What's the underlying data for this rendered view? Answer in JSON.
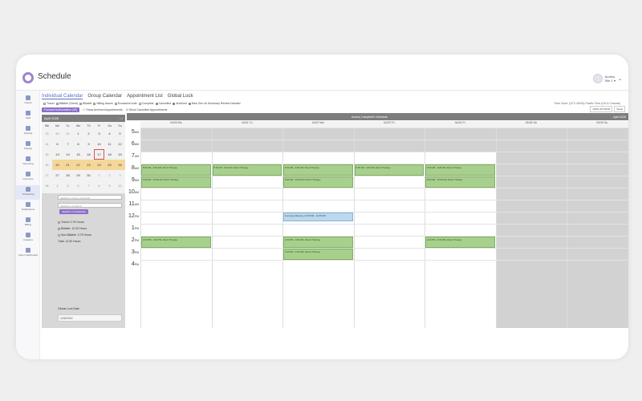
{
  "app": {
    "title": "Schedule"
  },
  "user": {
    "name": "Audrey",
    "role": "Site 1 ▾"
  },
  "nav": [
    {
      "label": "Clients",
      "icon": "person-icon"
    },
    {
      "label": "Staff",
      "icon": "staff-icon"
    },
    {
      "label": "Settings",
      "icon": "gear-icon"
    },
    {
      "label": "Payday",
      "icon": "payday-icon"
    },
    {
      "label": "Reporting",
      "icon": "reporting-icon"
    },
    {
      "label": "Insurance",
      "icon": "insurance-icon"
    },
    {
      "label": "Scheduling",
      "icon": "calendar-icon"
    },
    {
      "label": "Notifications",
      "icon": "bell-icon"
    },
    {
      "label": "Billing",
      "icon": "billing-icon"
    },
    {
      "label": "Analytics",
      "icon": "analytics-icon"
    },
    {
      "label": "Admin Dashboard",
      "icon": "dashboard-icon"
    }
  ],
  "tabs": [
    "Individual Calendar",
    "Group Calendar",
    "Appointment List",
    "Global Lock"
  ],
  "legend": [
    {
      "label": "Travel",
      "color": "#f4e3a1"
    },
    {
      "label": "Billable (Client)",
      "color": "#a8d08d"
    },
    {
      "label": "Billable",
      "color": "#a8d08d"
    },
    {
      "label": "Billing Issues",
      "color": "#f4b183"
    },
    {
      "label": "Excessive Auth",
      "color": "#f4b183"
    },
    {
      "label": "Complete",
      "color": "#ffffff"
    },
    {
      "label": "Cancelled",
      "color": "#c0392b"
    },
    {
      "label": "Archived",
      "color": "#333333"
    },
    {
      "label": "New Gen-AI Summary Review Needed",
      "color": "#c0392b"
    }
  ],
  "timezone": "Time Zone: (UTC-08:00) Pacific Time (US & Canada)",
  "toolbar": {
    "button": "Forward Authorization (49)",
    "show_archived": "Show Archived Appointments",
    "show_cancelled": "Show Cancelled Appointments",
    "view_option_label": "VIEW OPTIONS",
    "view_option_value": "Week"
  },
  "mini_calendar": {
    "month": "April 2026",
    "dow": [
      "Wk",
      "Mo",
      "Tu",
      "We",
      "Th",
      "Fr",
      "Sa",
      "Su"
    ],
    "rows": [
      {
        "wk": "13",
        "days": [
          "30",
          "31",
          "1",
          "2",
          "3",
          "4",
          "5"
        ]
      },
      {
        "wk": "14",
        "days": [
          "6",
          "7",
          "8",
          "9",
          "10",
          "11",
          "12"
        ]
      },
      {
        "wk": "15",
        "days": [
          "13",
          "14",
          "15",
          "16",
          "17",
          "18",
          "19"
        ]
      },
      {
        "wk": "16",
        "days": [
          "20",
          "21",
          "22",
          "23",
          "24",
          "25",
          "26"
        ]
      },
      {
        "wk": "17",
        "days": [
          "27",
          "28",
          "29",
          "30",
          "1",
          "2",
          "3"
        ]
      },
      {
        "wk": "18",
        "days": [
          "4",
          "5",
          "6",
          "7",
          "8",
          "9",
          "10"
        ]
      }
    ]
  },
  "left_panel": {
    "search1": "SEARCH: Audrey Campbell",
    "search2": "SEARCH: CLIENTS",
    "button": "SEARCH CALENDAR",
    "summary": [
      {
        "label": "Travel: 0.75 Hours",
        "color": "#f4e3a1"
      },
      {
        "label": "Billable: 12.00 Hours",
        "color": "#a8d08d"
      },
      {
        "label": "Non-Billable: 0.75 Hours",
        "color": "#ffffff"
      },
      {
        "label": "Total: 14.00 Hours",
        "color": ""
      }
    ],
    "lock_label": "Global Lock Date",
    "lock_date": "12/6/2024"
  },
  "grid": {
    "banner": "Audrey Campbell's Schedule",
    "banner_right": "April 2026",
    "days": [
      "04/20 Mo",
      "04/21 Tu",
      "04/22 We",
      "04/23 Th",
      "04/24 Fr",
      "04/25 Sa",
      "04/26 Su"
    ],
    "hours": [
      {
        "h": "5",
        "ap": "AM"
      },
      {
        "h": "6",
        "ap": "AM"
      },
      {
        "h": "7",
        "ap": "AM"
      },
      {
        "h": "8",
        "ap": "AM"
      },
      {
        "h": "9",
        "ap": "AM"
      },
      {
        "h": "10",
        "ap": "AM"
      },
      {
        "h": "11",
        "ap": "AM"
      },
      {
        "h": "12",
        "ap": "PM"
      },
      {
        "h": "1",
        "ap": "PM"
      },
      {
        "h": "2",
        "ap": "PM"
      },
      {
        "h": "3",
        "ap": "PM"
      },
      {
        "h": "4",
        "ap": "PM"
      }
    ],
    "appointments": [
      {
        "day": 0,
        "start": 8,
        "end": 9,
        "type": "green",
        "text": "8:00 AM - 9:00 AM, Direct Therapy"
      },
      {
        "day": 0,
        "start": 9,
        "end": 10,
        "type": "green",
        "text": "9:00 AM - 10:30 AM, Direct Therapy"
      },
      {
        "day": 0,
        "start": 14,
        "end": 15,
        "type": "green",
        "text": "2:00 PM - 3:00 PM, Direct Therapy"
      },
      {
        "day": 1,
        "start": 8,
        "end": 9,
        "type": "green",
        "text": "8:00 AM - 9:00 AM, Direct Therapy"
      },
      {
        "day": 2,
        "start": 8,
        "end": 9,
        "type": "green",
        "text": "8:00 AM - 9:00 AM, Direct Therapy"
      },
      {
        "day": 2,
        "start": 9,
        "end": 10,
        "type": "green",
        "text": "9:00 AM - 10:30 AM, Direct Therapy"
      },
      {
        "day": 2,
        "start": 12,
        "end": 12.8,
        "type": "blue",
        "text": "Company Meeting, 12:00 PM - 12:45 PM"
      },
      {
        "day": 2,
        "start": 14,
        "end": 15,
        "type": "green",
        "text": "2:00 PM - 3:00 PM, Parent Training"
      },
      {
        "day": 2,
        "start": 15,
        "end": 16,
        "type": "green",
        "text": "3:00 PM - 4:00 PM, Parent Training"
      },
      {
        "day": 3,
        "start": 8,
        "end": 9,
        "type": "green",
        "text": "8:00 AM - 9:00 AM, Direct Therapy"
      },
      {
        "day": 4,
        "start": 8,
        "end": 9,
        "type": "green",
        "text": "8:00 AM - 9:00 AM, Direct Therapy"
      },
      {
        "day": 4,
        "start": 9,
        "end": 10,
        "type": "green",
        "text": "9:00 AM - 10:30 AM, Direct Therapy"
      },
      {
        "day": 4,
        "start": 14,
        "end": 15,
        "type": "green",
        "text": "2:00 PM - 3:00 PM, Direct Therapy"
      }
    ]
  }
}
